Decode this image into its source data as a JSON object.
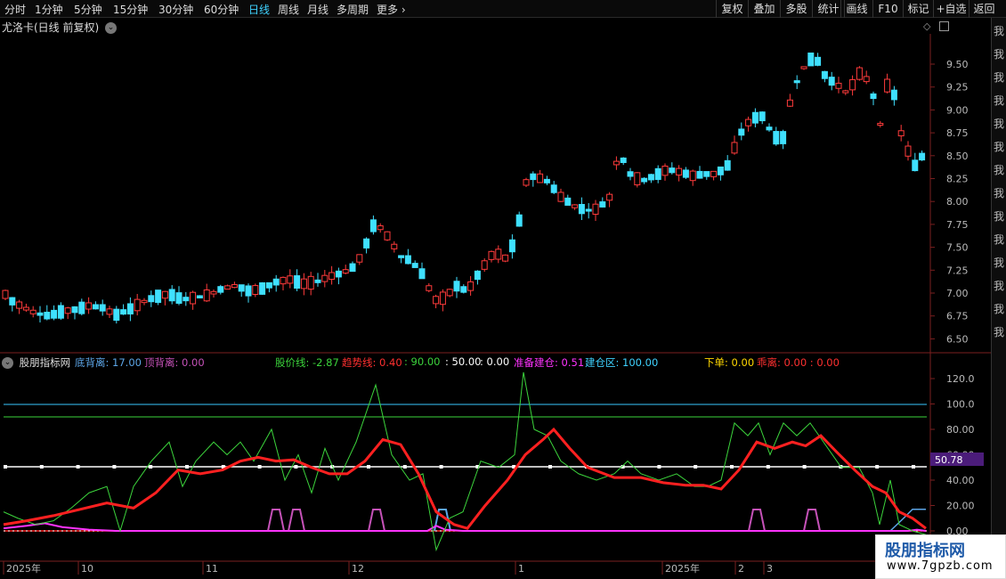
{
  "toolbar": {
    "periods": [
      {
        "label": "分时",
        "active": false
      },
      {
        "label": "1分钟",
        "active": false
      },
      {
        "label": "5分钟",
        "active": false
      },
      {
        "label": "15分钟",
        "active": false
      },
      {
        "label": "30分钟",
        "active": false
      },
      {
        "label": "60分钟",
        "active": false
      },
      {
        "label": "日线",
        "active": true
      },
      {
        "label": "周线",
        "active": false
      },
      {
        "label": "月线",
        "active": false
      },
      {
        "label": "多周期",
        "active": false
      },
      {
        "label": "更多",
        "active": false
      }
    ],
    "tools": [
      "复权",
      "叠加",
      "多股",
      "统计",
      "画线",
      "F10",
      "标记",
      "+自选",
      "返回"
    ]
  },
  "upper_panel": {
    "title": "尤洛卡(日线 前复权)",
    "price_axis": [
      "9.50",
      "9.25",
      "9.00",
      "8.75",
      "8.50",
      "8.25",
      "8.00",
      "7.75",
      "7.50",
      "7.25",
      "7.00",
      "6.75",
      "6.50"
    ],
    "colors": {
      "up": "#ff3b3b",
      "down": "#3fe0ff"
    }
  },
  "lower_panel": {
    "indicator_name": "股朋指标网",
    "legend": [
      {
        "label": "底背离: 17.00",
        "color": "#5da6e8"
      },
      {
        "label": "顶背离: 0.00",
        "color": "#c552b8"
      },
      {
        "label": "股价线: -2.87",
        "color": "#3cd43c"
      },
      {
        "label": "趋势线: 0.40",
        "color": "#ff3030"
      },
      {
        "label": ": 90.00",
        "color": "#3cd43c"
      },
      {
        "label": ": 50.00",
        "color": "#ffffff"
      },
      {
        "label": ": 0.00",
        "color": "#ffffff"
      },
      {
        "label": "准备建仓: 0.51",
        "color": "#ff33ff"
      },
      {
        "label": "建仓区: 100.00",
        "color": "#3fd2ff"
      },
      {
        "label": "下单: 0.00",
        "color": "#ffd700"
      },
      {
        "label": "乖离: 0.00 : 0.00",
        "color": "#ff3030"
      }
    ],
    "axis_labels": [
      "120.0",
      "100.0",
      "80.00",
      "60.00",
      "40.00",
      "20.00",
      "0.00"
    ],
    "current_value": "50.78",
    "colors": {
      "price_line": "#3cd43c",
      "trend_line": "#ff2020",
      "line_100": "#39c8ff",
      "line_90": "#3cd43c",
      "line_50": "#ffffff",
      "bottom_div": "#5da6e8",
      "top_div": "#c552b8"
    }
  },
  "date_axis": [
    "2025年",
    "10",
    "11",
    "12",
    "1",
    "2025年",
    "2",
    "3"
  ],
  "side_strip_chars": [
    "我",
    "我",
    "我",
    "我",
    "我",
    "我",
    "我",
    "我",
    "我",
    "我",
    "我",
    "我",
    "我",
    "我"
  ],
  "watermark": {
    "title": "股朋指标网",
    "url": "www.7gpzb.com"
  }
}
